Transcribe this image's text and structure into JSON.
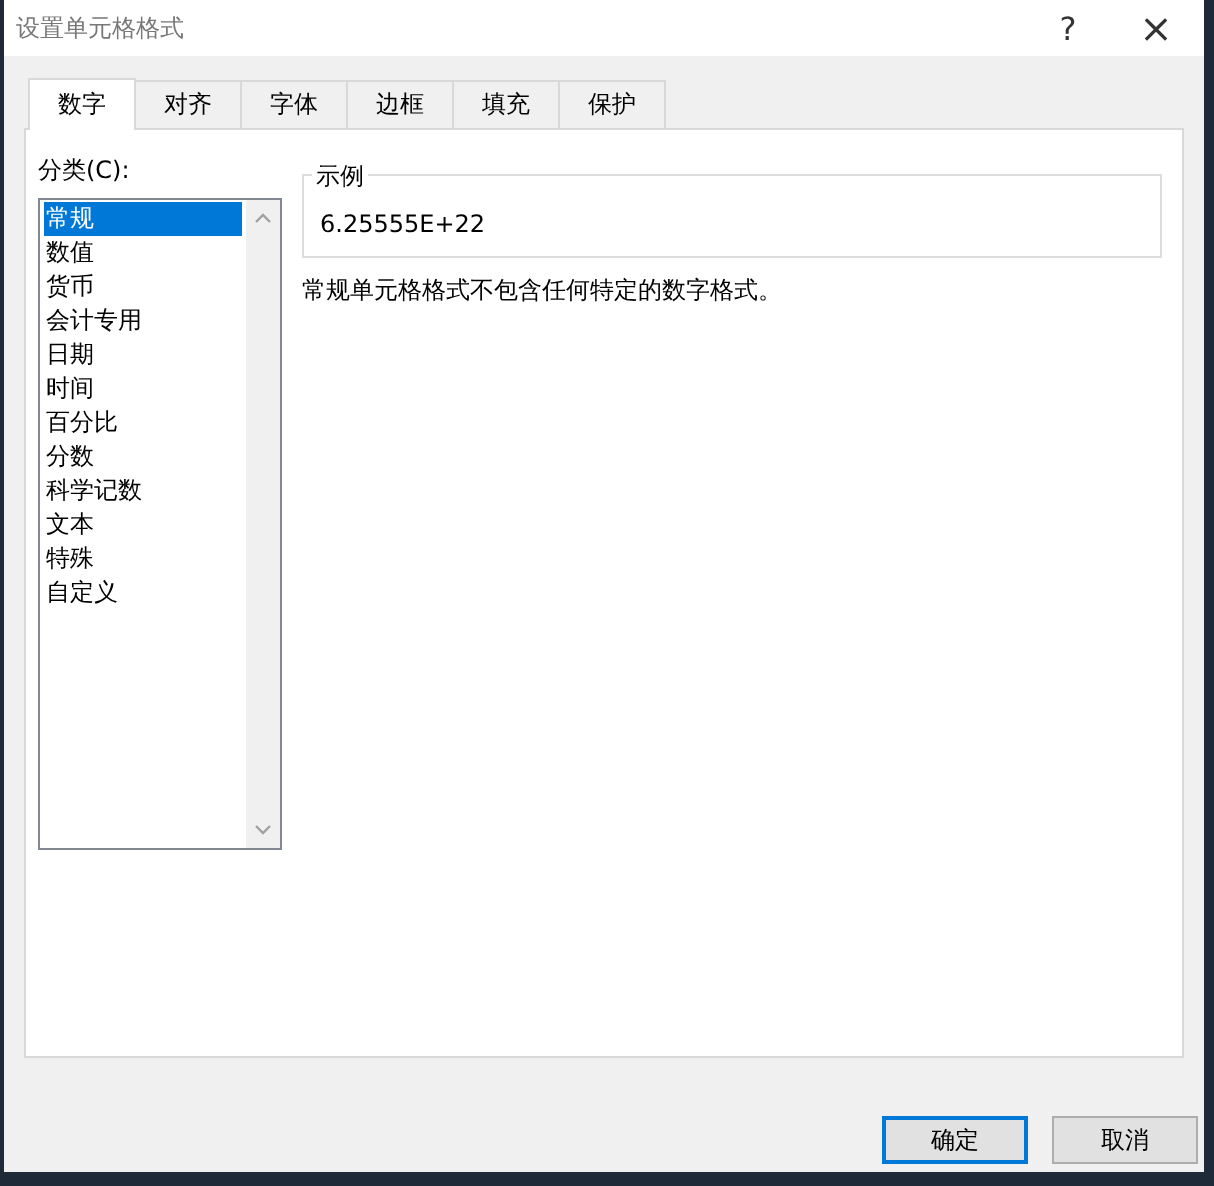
{
  "window": {
    "title": "设置单元格格式",
    "help": "?",
    "close": "×"
  },
  "tabs": [
    {
      "label": "数字",
      "selected": true
    },
    {
      "label": "对齐",
      "selected": false
    },
    {
      "label": "字体",
      "selected": false
    },
    {
      "label": "边框",
      "selected": false
    },
    {
      "label": "填充",
      "selected": false
    },
    {
      "label": "保护",
      "selected": false
    }
  ],
  "category": {
    "label": "分类(C):",
    "items": [
      {
        "label": "常规",
        "selected": true
      },
      {
        "label": "数值",
        "selected": false
      },
      {
        "label": "货币",
        "selected": false
      },
      {
        "label": "会计专用",
        "selected": false
      },
      {
        "label": "日期",
        "selected": false
      },
      {
        "label": "时间",
        "selected": false
      },
      {
        "label": "百分比",
        "selected": false
      },
      {
        "label": "分数",
        "selected": false
      },
      {
        "label": "科学记数",
        "selected": false
      },
      {
        "label": "文本",
        "selected": false
      },
      {
        "label": "特殊",
        "selected": false
      },
      {
        "label": "自定义",
        "selected": false
      }
    ]
  },
  "sample": {
    "label": "示例",
    "value": "6.25555E+22"
  },
  "description": "常规单元格格式不包含任何特定的数字格式。",
  "buttons": [
    {
      "label": "确定",
      "default": true
    },
    {
      "label": "取消",
      "default": false
    }
  ]
}
